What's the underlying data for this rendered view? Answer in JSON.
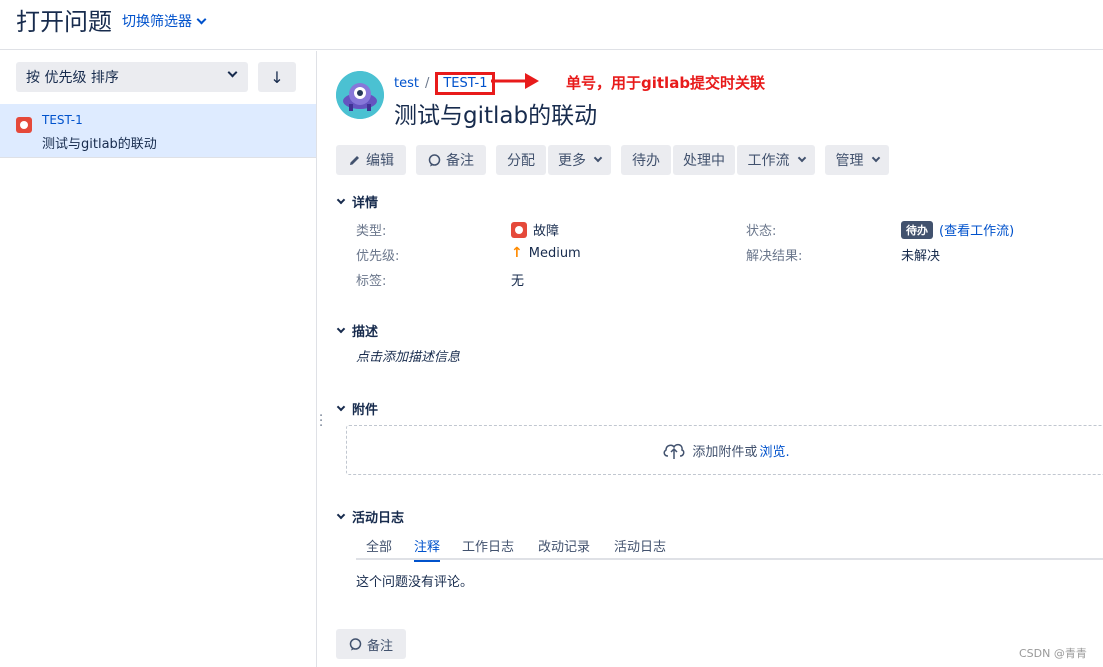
{
  "header": {
    "title": "打开问题",
    "switch_filter": "切换筛选器"
  },
  "sidebar": {
    "sort_label": "按 优先级 排序",
    "sort_direction_icon": "↓",
    "items": [
      {
        "key": "TEST-1",
        "summary": "测试与gitlab的联动"
      }
    ]
  },
  "issue": {
    "project": "test",
    "separator": "/",
    "key": "TEST-1",
    "title": "测试与gitlab的联动"
  },
  "annotation": {
    "text": "单号，用于gitlab提交时关联",
    "color": "#e81b1b"
  },
  "toolbar": {
    "edit": "编辑",
    "comment": "备注",
    "assign": "分配",
    "more": "更多",
    "todo": "待办",
    "in_progress": "处理中",
    "workflow": "工作流",
    "admin": "管理"
  },
  "details": {
    "heading": "详情",
    "type_label": "类型:",
    "type_value": "故障",
    "priority_label": "优先级:",
    "priority_value": "Medium",
    "labels_label": "标签:",
    "labels_value": "无",
    "status_label": "状态:",
    "status_value": "待办",
    "status_link": "(查看工作流)",
    "resolution_label": "解决结果:",
    "resolution_value": "未解决"
  },
  "description": {
    "heading": "描述",
    "placeholder": "点击添加描述信息"
  },
  "attachments": {
    "heading": "附件",
    "drop_text": "添加附件或",
    "browse_link": "浏览."
  },
  "activity": {
    "heading": "活动日志",
    "tabs": [
      "全部",
      "注释",
      "工作日志",
      "改动记录",
      "活动日志"
    ],
    "active_tab": "注释",
    "empty_text": "这个问题没有评论。",
    "comment_button": "备注"
  },
  "watermark": "CSDN @青青",
  "colors": {
    "link": "#0052cc",
    "bug": "#e5493a",
    "selected_bg": "#deebff",
    "button_bg": "#ebecf0"
  }
}
